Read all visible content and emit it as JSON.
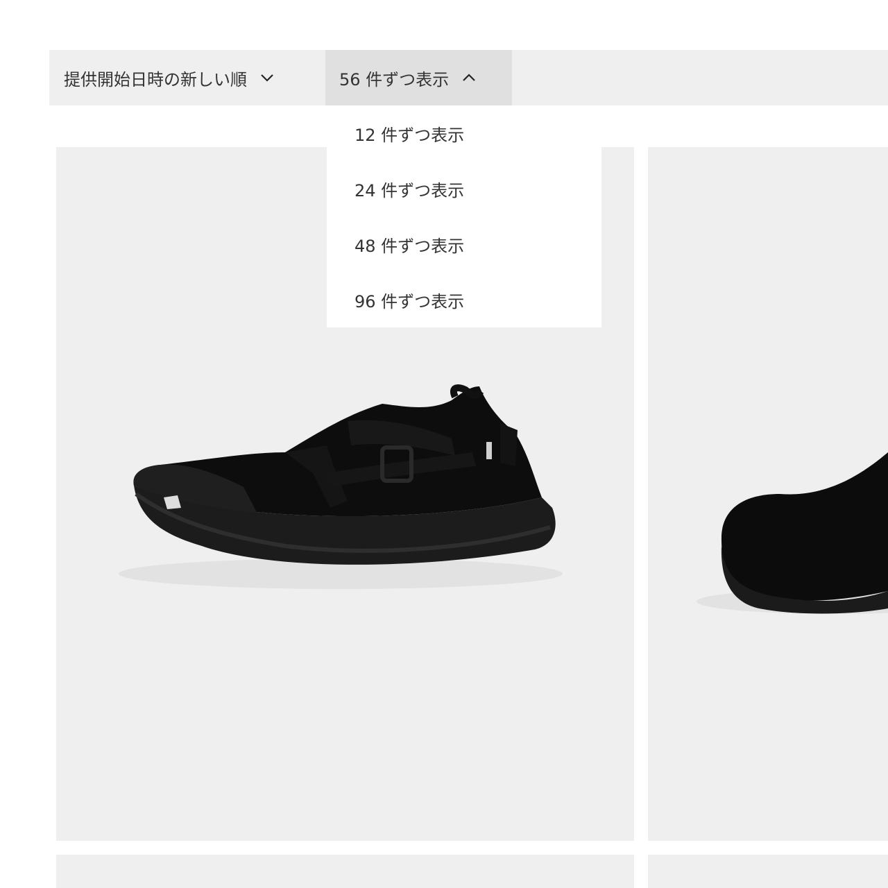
{
  "toolbar": {
    "sort_label": "提供開始日時の新しい順",
    "count_label": "56 件ずつ表示"
  },
  "dropdown": {
    "options": [
      "12 件ずつ表示",
      "24 件ずつ表示",
      "48 件ずつ表示",
      "96 件ずつ表示"
    ]
  },
  "icons": {
    "sort_chevron": "chevron-down-icon",
    "count_chevron": "chevron-up-icon"
  },
  "colors": {
    "toolbar_bg": "#efefef",
    "active_button_bg": "#e0e0e0",
    "card_bg": "#efefef"
  }
}
